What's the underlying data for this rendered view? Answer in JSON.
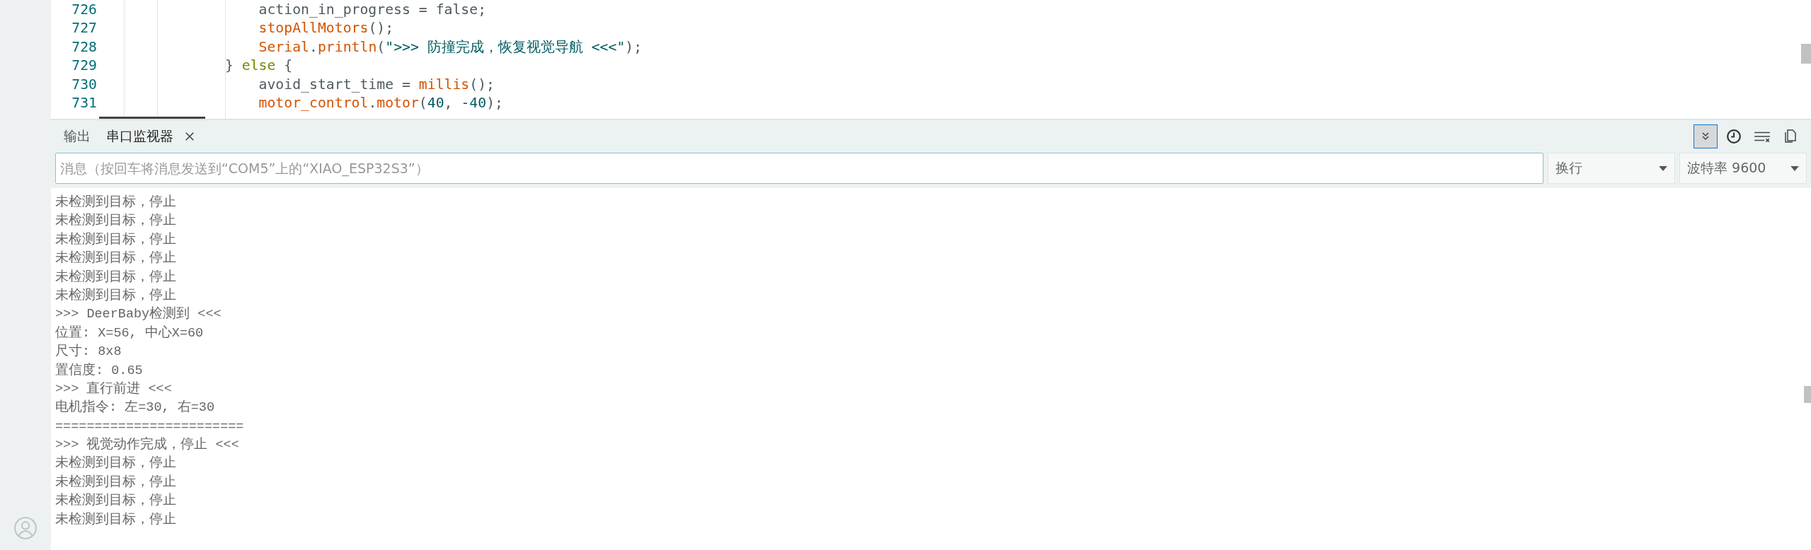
{
  "editor": {
    "lines": [
      {
        "number": "726",
        "tokens": [
          {
            "text": "                action_in_progress = false;",
            "kind": "plain"
          }
        ]
      },
      {
        "number": "727",
        "tokens": [
          {
            "text": "                stopAllMotors",
            "kind": "function"
          },
          {
            "text": "();",
            "kind": "plain"
          }
        ]
      },
      {
        "number": "728",
        "tokens": [
          {
            "text": "                Serial",
            "kind": "function"
          },
          {
            "text": ".",
            "kind": "plain"
          },
          {
            "text": "println",
            "kind": "function"
          },
          {
            "text": "(",
            "kind": "plain"
          },
          {
            "text": "\">>> 防撞完成，恢复视觉导航 <<<\"",
            "kind": "string"
          },
          {
            "text": ");",
            "kind": "plain"
          }
        ]
      },
      {
        "number": "729",
        "tokens": [
          {
            "text": "            } ",
            "kind": "plain"
          },
          {
            "text": "else",
            "kind": "keyword"
          },
          {
            "text": " {",
            "kind": "plain"
          }
        ]
      },
      {
        "number": "730",
        "tokens": [
          {
            "text": "                avoid_start_time = ",
            "kind": "plain"
          },
          {
            "text": "millis",
            "kind": "function"
          },
          {
            "text": "();",
            "kind": "plain"
          }
        ]
      },
      {
        "number": "731",
        "tokens": [
          {
            "text": "                motor_control",
            "kind": "function"
          },
          {
            "text": ".",
            "kind": "plain"
          },
          {
            "text": "motor",
            "kind": "function"
          },
          {
            "text": "(",
            "kind": "plain"
          },
          {
            "text": "40",
            "kind": "number"
          },
          {
            "text": ", ",
            "kind": "plain"
          },
          {
            "text": "-40",
            "kind": "number"
          },
          {
            "text": ");",
            "kind": "plain"
          }
        ]
      }
    ]
  },
  "serial_panel": {
    "tabs": [
      {
        "label": "输出",
        "selected": false,
        "closable": false
      },
      {
        "label": "串口监视器",
        "selected": true,
        "closable": true
      }
    ],
    "toolbar": [
      {
        "kind": "autoscroll",
        "on": true
      },
      {
        "kind": "timestamp",
        "on": false
      },
      {
        "kind": "clear",
        "on": false
      },
      {
        "kind": "copy",
        "on": false
      }
    ],
    "message_field": {
      "placeholder": "消息（按回车将消息发送到“COM5”上的“XIAO_ESP32S3”）"
    },
    "line_ending": {
      "value": "换行"
    },
    "baud_rate": {
      "value": "波特率 9600"
    },
    "output": [
      "未检测到目标，停止",
      "未检测到目标，停止",
      "未检测到目标，停止",
      "未检测到目标，停止",
      "未检测到目标，停止",
      "未检测到目标，停止",
      ">>> DeerBaby检测到 <<<",
      "位置: X=56, 中心X=60",
      "尺寸: 8x8",
      "置信度: 0.65",
      ">>> 直行前进 <<<",
      "电机指令: 左=30, 右=30",
      "========================",
      ">>> 视觉动作完成，停止 <<<",
      "未检测到目标，停止",
      "未检测到目标，停止",
      "未检测到目标，停止",
      "未检测到目标，停止"
    ]
  }
}
